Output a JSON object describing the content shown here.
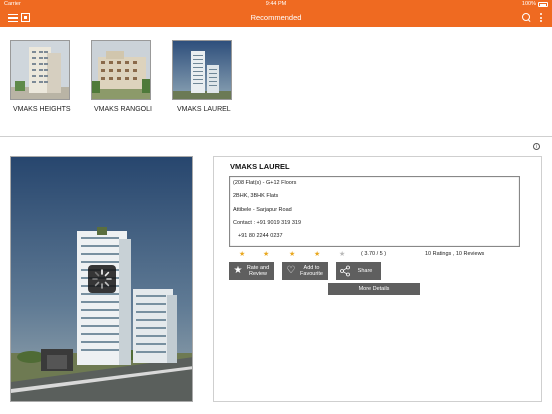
{
  "status_bar": {
    "carrier": "Carrier",
    "time": "9:44 PM",
    "battery": "100%"
  },
  "navbar": {
    "title": "Recommended"
  },
  "thumbnails": [
    {
      "label": "VMAKS HEIGHTS"
    },
    {
      "label": "VMAKS RANGOLI"
    },
    {
      "label": "VMAKS LAUREL"
    }
  ],
  "detail": {
    "title": "VMAKS LAUREL",
    "info_lines": [
      "(208 Flat(s)  - G+12 Floors",
      "2BHK, 3BHK Flats",
      "Attibele - Sarjapur Road",
      "Contact : +91 9019 319 319",
      "+91 80 2244 0237"
    ],
    "rating": {
      "value": 3.7,
      "max": 5,
      "text": "( 3.70 / 5 )",
      "count_text": "10 Ratings , 10 Reviews"
    },
    "buttons": {
      "rate": "Rate and Review",
      "favourite": "Add to Favourite",
      "share": "Share",
      "more_details": "More Details"
    }
  },
  "colors": {
    "accent": "#ef6a21",
    "button": "#5f5f5f",
    "star": "#e9a820"
  },
  "icons": [
    "hamburger-icon",
    "home-icon",
    "search-icon",
    "more-icon",
    "info-icon",
    "star-icon",
    "heart-icon",
    "share-icon"
  ]
}
